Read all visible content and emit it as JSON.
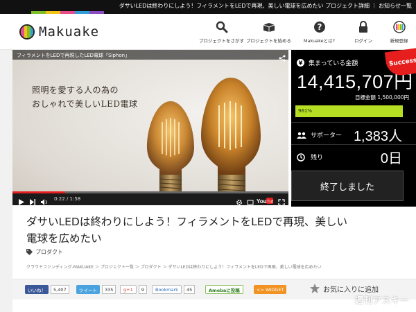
{
  "topbar": {
    "text": "ダサいLEDは終わりにしよう！フィラメントをLEDで再現、美しい電球を広めたい プロジェクト詳細 ｜ お知らせ一覧",
    "rainbow_colors": [
      "#7fbe27",
      "#f0c419",
      "#e94c89",
      "#2f9fd8",
      "#8a4cc0"
    ]
  },
  "header": {
    "logo_text": "Makuake",
    "logo_colors": [
      "#e94c89",
      "#f0c419",
      "#7fbe27",
      "#2f9fd8"
    ],
    "nav": [
      {
        "label": "プロジェクトをさがす",
        "icon": "search-icon"
      },
      {
        "label": "プロジェクトを始める",
        "icon": "box-icon"
      },
      {
        "label": "Makuakeとは?",
        "icon": "help-icon"
      },
      {
        "label": "ログイン",
        "icon": "lock-icon"
      },
      {
        "label": "新規登録",
        "icon": "register-icon"
      }
    ]
  },
  "video": {
    "title": "フィラメントをLEDで再現したLED電球「Siphon」",
    "caption_line1": "照明を愛する人の為の",
    "caption_line2": "おしゃれで美しいLED電球",
    "time": "0:22 / 1:58",
    "progress_fraction": 0.19
  },
  "stats": {
    "raised_label": "集まっている金額",
    "raised_amount": "14,415,707円",
    "goal": "目標金額 1,500,000円",
    "percent_text": "961%",
    "supporters_label": "サポーター",
    "supporters_value": "1,383人",
    "remaining_label": "残り",
    "remaining_value": "0日",
    "ended_label": "終了しました",
    "success_badge": "Success!",
    "accent": "#b6df24",
    "badge_color": "#e61e1e"
  },
  "project": {
    "title_line1": "ダサいLEDは終わりにしよう！フィラメントをLEDで再現、美しい",
    "title_line2": "電球を広めたい",
    "tag": "プロダクト",
    "breadcrumb": "クラウドファンディング-MAKUAKE ＞ プロジェクト一覧 ＞ プロダクト ＞ ダサいLEDは終わりにしよう！フィラメントをLEDで再現、美しい電球を広めたい"
  },
  "social": {
    "like_label": "いいね！",
    "like_count": "5,407",
    "tweet_label": "ツイート",
    "tweet_count": "335",
    "gplus_label": "g+1",
    "gplus_count": "9",
    "bookmark_label": "Bookmark",
    "bookmark_count": "45",
    "ameba_label": "Amebaに投稿",
    "widget_label": "<> WIDGET",
    "favorite_label": "お気に入りに追加"
  },
  "watermark": "週刊アスキー"
}
